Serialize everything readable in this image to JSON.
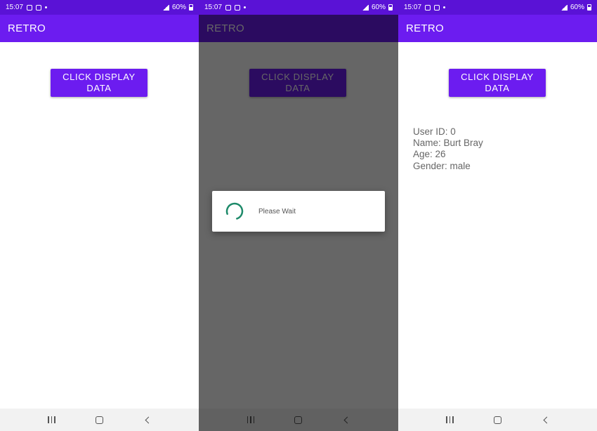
{
  "status_bar": {
    "time": "15:07",
    "battery": "60%"
  },
  "app": {
    "title": "RETRO",
    "display_button_label": "CLICK DISPLAY DATA"
  },
  "dialog": {
    "message": "Please Wait"
  },
  "user": {
    "id_line": "User ID: 0",
    "name_line": "Name: Burt Bray",
    "age_line": "Age: 26",
    "gender_line": "Gender: male"
  },
  "colors": {
    "status_bar": "#5a12d6",
    "app_bar": "#6c1cf0",
    "button": "#6c1cf0",
    "spinner": "#1e8a6a"
  },
  "icons": {
    "nav": [
      "recent-apps-icon",
      "home-icon",
      "back-icon"
    ]
  }
}
